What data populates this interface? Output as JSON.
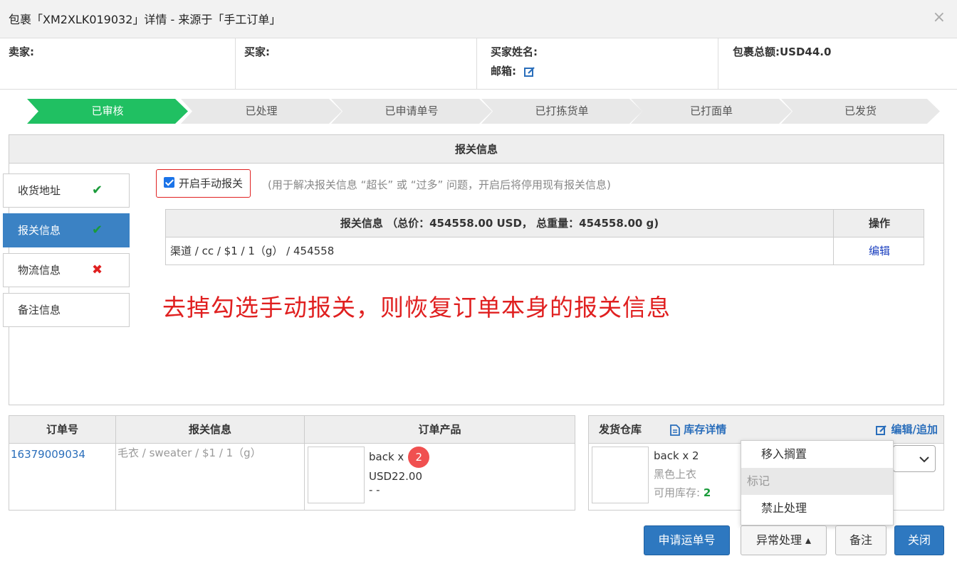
{
  "dialog": {
    "title": "包裹「XM2XLK019032」详情 - 来源于「手工订单」",
    "close_glyph": "×"
  },
  "info": {
    "seller_label": "卖家:",
    "buyer_label": "买家:",
    "buyer_name_label": "买家姓名:",
    "email_label": "邮箱:",
    "total_label": "包裹总额:",
    "total_value": "USD44.0"
  },
  "steps": [
    "已审核",
    "已处理",
    "已申请单号",
    "已打拣货单",
    "已打面单",
    "已发货"
  ],
  "active_step": 0,
  "panel": {
    "title": "报关信息"
  },
  "tabs": [
    {
      "label": "收货地址",
      "status": "✔",
      "state": "ok"
    },
    {
      "label": "报关信息",
      "status": "✔",
      "state": "ok"
    },
    {
      "label": "物流信息",
      "status": "✖",
      "state": "bad"
    },
    {
      "label": "备注信息",
      "status": "",
      "state": "none"
    }
  ],
  "manual_customs": {
    "checked": true,
    "label": "开启手动报关",
    "hint": "(用于解决报关信息 “超长” 或 “过多” 问题，开启后将停用现有报关信息)"
  },
  "customs_table": {
    "header": "报关信息 （总价：454558.00 USD， 总重量：454558.00 g)",
    "action_header": "操作",
    "row": "渠道 / cc / $1 / 1（g） / 454558",
    "action": "编辑"
  },
  "annotation": "去掉勾选手动报关，则恢复订单本身的报关信息",
  "order_table": {
    "headers": [
      "订单号",
      "报关信息",
      "订单产品"
    ],
    "order_no": "16379009034",
    "customs": "毛衣 / sweater / $1 / 1（g）",
    "product_line1": "back x",
    "qty_badge": "2",
    "price": "USD22.00",
    "extra": "- -"
  },
  "warehouse": {
    "label": "发货仓库",
    "stock_link": "库存详情",
    "edit_link": "编辑/追加",
    "item": "back x 2",
    "desc": "黑色上衣",
    "stock_label": "可用库存:",
    "stock_value": "2"
  },
  "dropdown": {
    "item1": "移入搁置",
    "group": "标记",
    "item2": "禁止处理"
  },
  "buttons": {
    "apply": "申请运单号",
    "exception": "异常处理 ▴",
    "note": "备注",
    "close": "关闭"
  }
}
